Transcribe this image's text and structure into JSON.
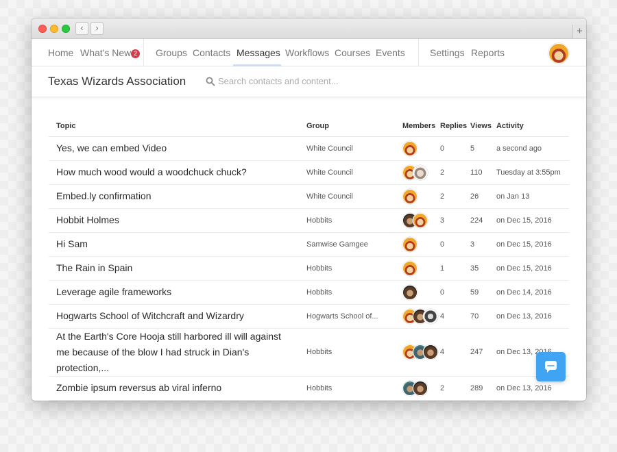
{
  "nav": {
    "items": [
      {
        "label": "Home"
      },
      {
        "label": "What's New"
      },
      {
        "label": "Groups"
      },
      {
        "label": "Contacts"
      },
      {
        "label": "Messages"
      },
      {
        "label": "Workflows"
      },
      {
        "label": "Courses"
      },
      {
        "label": "Events"
      },
      {
        "label": "Settings"
      },
      {
        "label": "Reports"
      }
    ],
    "whats_new_badge": "2",
    "active": "Messages"
  },
  "header": {
    "org_title": "Texas Wizards Association",
    "search_placeholder": "Search contacts and content..."
  },
  "table": {
    "headers": {
      "topic": "Topic",
      "group": "Group",
      "members": "Members",
      "replies": "Replies",
      "views": "Views",
      "activity": "Activity"
    },
    "rows": [
      {
        "topic": "Yes, we can embed Video",
        "group": "White Council",
        "members": [
          "wizard"
        ],
        "replies": "0",
        "views": "5",
        "activity": "a second ago"
      },
      {
        "topic": "How much wood would a woodchuck chuck?",
        "group": "White Council",
        "members": [
          "wizard",
          "white-wizard"
        ],
        "replies": "2",
        "views": "110",
        "activity": "Tuesday at 3:55pm"
      },
      {
        "topic": "Embed.ly confirmation",
        "group": "White Council",
        "members": [
          "wizard"
        ],
        "replies": "2",
        "views": "26",
        "activity": "on Jan 13"
      },
      {
        "topic": "Hobbit Holmes",
        "group": "Hobbits",
        "members": [
          "dark-hair",
          "wizard"
        ],
        "replies": "3",
        "views": "224",
        "activity": "on Dec 15, 2016"
      },
      {
        "topic": "Hi Sam",
        "group": "Samwise Gamgee",
        "members": [
          "wizard"
        ],
        "replies": "0",
        "views": "3",
        "activity": "on Dec 15, 2016"
      },
      {
        "topic": "The Rain in Spain",
        "group": "Hobbits",
        "members": [
          "wizard"
        ],
        "replies": "1",
        "views": "35",
        "activity": "on Dec 15, 2016"
      },
      {
        "topic": "Leverage agile frameworks",
        "group": "Hobbits",
        "members": [
          "dark-hair"
        ],
        "replies": "0",
        "views": "59",
        "activity": "on Dec 14, 2016"
      },
      {
        "topic": "Hogwarts School of Witchcraft and Wizardry",
        "group": "Hogwarts School of...",
        "members": [
          "wizard",
          "dark-hair",
          "bw"
        ],
        "replies": "4",
        "views": "70",
        "activity": "on Dec 13, 2016"
      },
      {
        "topic": "At the Earth's Core Hooja still harbored ill will against me because of the blow I had struck in Dian's protection,...",
        "group": "Hobbits",
        "members": [
          "wizard",
          "teal",
          "dark-hair"
        ],
        "replies": "4",
        "views": "247",
        "activity": "on Dec 13, 2016"
      },
      {
        "topic": "Zombie ipsum reversus ab viral inferno",
        "group": "Hobbits",
        "members": [
          "teal",
          "dark-hair"
        ],
        "replies": "2",
        "views": "289",
        "activity": "on Dec 13, 2016"
      }
    ]
  },
  "colors": {
    "accent": "#41a4f2",
    "badge": "#d33c4a",
    "active_tab_underline": "#cfdcef"
  },
  "icons": {
    "search": "search-icon",
    "chat": "chat-bubble-icon",
    "back": "chevron-left-icon",
    "forward": "chevron-right-icon",
    "new_tab": "plus-icon"
  }
}
